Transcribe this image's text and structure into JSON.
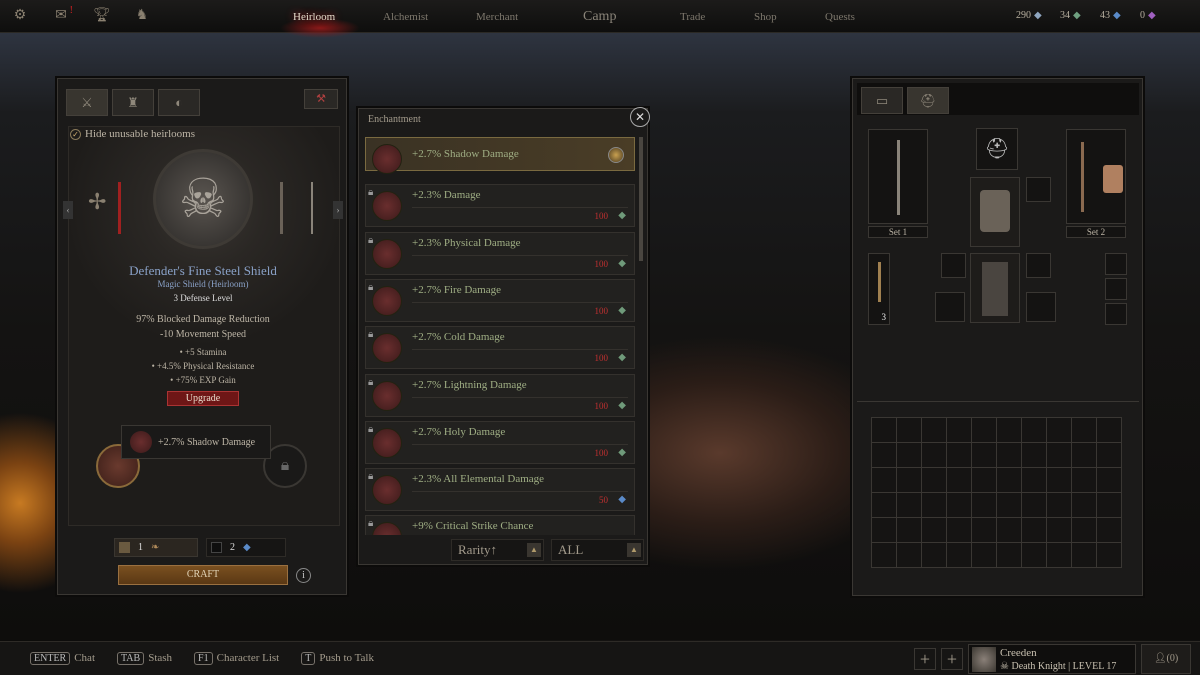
{
  "topbar": {
    "icons": [
      "settings-icon",
      "mail-icon",
      "trophy-icon",
      "emote-icon"
    ],
    "nav": [
      "Heirloom",
      "Alchemist",
      "Merchant",
      "Camp",
      "Trade",
      "Shop",
      "Quests"
    ],
    "active": "Heirloom",
    "currencies": [
      {
        "value": "290",
        "color": "#8fa6c0"
      },
      {
        "value": "34",
        "color": "#6fa080"
      },
      {
        "value": "43",
        "color": "#5a8ac8"
      },
      {
        "value": "0",
        "color": "#a060c0"
      }
    ]
  },
  "left": {
    "hide_label": "Hide unusable heirlooms",
    "hide_checked": true,
    "item": {
      "name": "Defender's Fine Steel Shield",
      "type": "Magic Shield (Heirloom)",
      "level": "3 Defense Level",
      "stats": [
        "97% Blocked Damage Reduction",
        "-10 Movement Speed"
      ],
      "mods": [
        "• +5 Stamina",
        "• +4.5% Physical Resistance",
        "• +75% EXP Gain"
      ]
    },
    "upgrade": "Upgrade",
    "tooltip": "+2.7% Shadow Damage",
    "costs": [
      {
        "qty": "1"
      },
      {
        "qty": "2"
      }
    ],
    "craft": "CRAFT",
    "info": "i"
  },
  "enchant": {
    "title": "Enchantment",
    "rows": [
      {
        "label": "+2.7% Shadow Damage",
        "cost": "",
        "selected": true
      },
      {
        "label": "+2.3% Damage",
        "cost": "100"
      },
      {
        "label": "+2.3% Physical Damage",
        "cost": "100"
      },
      {
        "label": "+2.7% Fire Damage",
        "cost": "100"
      },
      {
        "label": "+2.7% Cold Damage",
        "cost": "100"
      },
      {
        "label": "+2.7% Lightning Damage",
        "cost": "100"
      },
      {
        "label": "+2.7% Holy Damage",
        "cost": "100"
      },
      {
        "label": "+2.3% All Elemental Damage",
        "cost": "50",
        "cost_color": "#5a8ac8"
      },
      {
        "label": "+9% Critical Strike Chance",
        "cost": ""
      }
    ],
    "sort": "Rarity↑",
    "filter": "ALL"
  },
  "right": {
    "set1": "Set 1",
    "set2": "Set 2",
    "utility_count": "3"
  },
  "bottom": {
    "hints": [
      {
        "key": "ENTER",
        "label": "Chat"
      },
      {
        "key": "TAB",
        "label": "Stash"
      },
      {
        "key": "F1",
        "label": "Character List"
      },
      {
        "key": "T",
        "label": "Push to Talk"
      }
    ],
    "player": {
      "name": "Creeden",
      "class": "Death Knight",
      "level": "LEVEL 17"
    },
    "party": "(0)"
  }
}
